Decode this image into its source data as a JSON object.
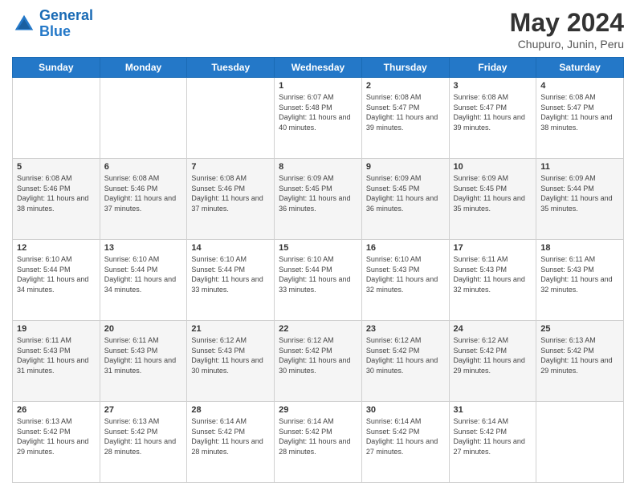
{
  "logo": {
    "line1": "General",
    "line2": "Blue"
  },
  "title": "May 2024",
  "subtitle": "Chupuro, Junin, Peru",
  "days_of_week": [
    "Sunday",
    "Monday",
    "Tuesday",
    "Wednesday",
    "Thursday",
    "Friday",
    "Saturday"
  ],
  "weeks": [
    [
      {
        "day": "",
        "sunrise": "",
        "sunset": "",
        "daylight": ""
      },
      {
        "day": "",
        "sunrise": "",
        "sunset": "",
        "daylight": ""
      },
      {
        "day": "",
        "sunrise": "",
        "sunset": "",
        "daylight": ""
      },
      {
        "day": "1",
        "sunrise": "6:07 AM",
        "sunset": "5:48 PM",
        "daylight": "11 hours and 40 minutes."
      },
      {
        "day": "2",
        "sunrise": "6:08 AM",
        "sunset": "5:47 PM",
        "daylight": "11 hours and 39 minutes."
      },
      {
        "day": "3",
        "sunrise": "6:08 AM",
        "sunset": "5:47 PM",
        "daylight": "11 hours and 39 minutes."
      },
      {
        "day": "4",
        "sunrise": "6:08 AM",
        "sunset": "5:47 PM",
        "daylight": "11 hours and 38 minutes."
      }
    ],
    [
      {
        "day": "5",
        "sunrise": "6:08 AM",
        "sunset": "5:46 PM",
        "daylight": "11 hours and 38 minutes."
      },
      {
        "day": "6",
        "sunrise": "6:08 AM",
        "sunset": "5:46 PM",
        "daylight": "11 hours and 37 minutes."
      },
      {
        "day": "7",
        "sunrise": "6:08 AM",
        "sunset": "5:46 PM",
        "daylight": "11 hours and 37 minutes."
      },
      {
        "day": "8",
        "sunrise": "6:09 AM",
        "sunset": "5:45 PM",
        "daylight": "11 hours and 36 minutes."
      },
      {
        "day": "9",
        "sunrise": "6:09 AM",
        "sunset": "5:45 PM",
        "daylight": "11 hours and 36 minutes."
      },
      {
        "day": "10",
        "sunrise": "6:09 AM",
        "sunset": "5:45 PM",
        "daylight": "11 hours and 35 minutes."
      },
      {
        "day": "11",
        "sunrise": "6:09 AM",
        "sunset": "5:44 PM",
        "daylight": "11 hours and 35 minutes."
      }
    ],
    [
      {
        "day": "12",
        "sunrise": "6:10 AM",
        "sunset": "5:44 PM",
        "daylight": "11 hours and 34 minutes."
      },
      {
        "day": "13",
        "sunrise": "6:10 AM",
        "sunset": "5:44 PM",
        "daylight": "11 hours and 34 minutes."
      },
      {
        "day": "14",
        "sunrise": "6:10 AM",
        "sunset": "5:44 PM",
        "daylight": "11 hours and 33 minutes."
      },
      {
        "day": "15",
        "sunrise": "6:10 AM",
        "sunset": "5:44 PM",
        "daylight": "11 hours and 33 minutes."
      },
      {
        "day": "16",
        "sunrise": "6:10 AM",
        "sunset": "5:43 PM",
        "daylight": "11 hours and 32 minutes."
      },
      {
        "day": "17",
        "sunrise": "6:11 AM",
        "sunset": "5:43 PM",
        "daylight": "11 hours and 32 minutes."
      },
      {
        "day": "18",
        "sunrise": "6:11 AM",
        "sunset": "5:43 PM",
        "daylight": "11 hours and 32 minutes."
      }
    ],
    [
      {
        "day": "19",
        "sunrise": "6:11 AM",
        "sunset": "5:43 PM",
        "daylight": "11 hours and 31 minutes."
      },
      {
        "day": "20",
        "sunrise": "6:11 AM",
        "sunset": "5:43 PM",
        "daylight": "11 hours and 31 minutes."
      },
      {
        "day": "21",
        "sunrise": "6:12 AM",
        "sunset": "5:43 PM",
        "daylight": "11 hours and 30 minutes."
      },
      {
        "day": "22",
        "sunrise": "6:12 AM",
        "sunset": "5:42 PM",
        "daylight": "11 hours and 30 minutes."
      },
      {
        "day": "23",
        "sunrise": "6:12 AM",
        "sunset": "5:42 PM",
        "daylight": "11 hours and 30 minutes."
      },
      {
        "day": "24",
        "sunrise": "6:12 AM",
        "sunset": "5:42 PM",
        "daylight": "11 hours and 29 minutes."
      },
      {
        "day": "25",
        "sunrise": "6:13 AM",
        "sunset": "5:42 PM",
        "daylight": "11 hours and 29 minutes."
      }
    ],
    [
      {
        "day": "26",
        "sunrise": "6:13 AM",
        "sunset": "5:42 PM",
        "daylight": "11 hours and 29 minutes."
      },
      {
        "day": "27",
        "sunrise": "6:13 AM",
        "sunset": "5:42 PM",
        "daylight": "11 hours and 28 minutes."
      },
      {
        "day": "28",
        "sunrise": "6:14 AM",
        "sunset": "5:42 PM",
        "daylight": "11 hours and 28 minutes."
      },
      {
        "day": "29",
        "sunrise": "6:14 AM",
        "sunset": "5:42 PM",
        "daylight": "11 hours and 28 minutes."
      },
      {
        "day": "30",
        "sunrise": "6:14 AM",
        "sunset": "5:42 PM",
        "daylight": "11 hours and 27 minutes."
      },
      {
        "day": "31",
        "sunrise": "6:14 AM",
        "sunset": "5:42 PM",
        "daylight": "11 hours and 27 minutes."
      },
      {
        "day": "",
        "sunrise": "",
        "sunset": "",
        "daylight": ""
      }
    ]
  ]
}
